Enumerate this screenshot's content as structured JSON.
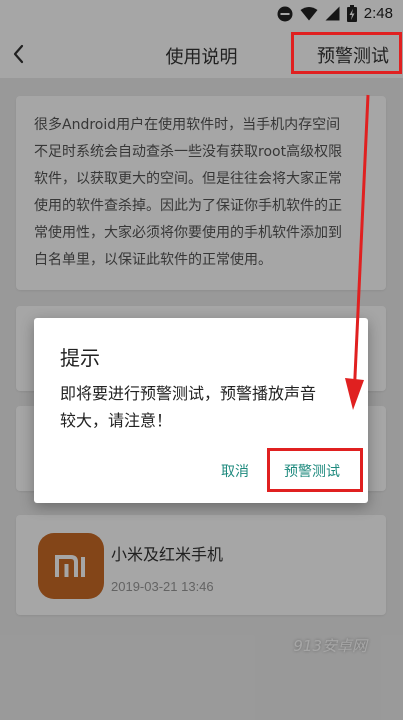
{
  "status_bar": {
    "time": "2:48"
  },
  "app_bar": {
    "title": "使用说明",
    "test_link": "预警测试"
  },
  "info_card": {
    "lines": [
      "很多Android用户在使用软件时，当手机内存空间",
      "不足时系统会自动查杀一些没有获取root高级权限",
      "软件，以获取更大的空间。但是往往会将大家正常",
      "使用的软件查杀掉。因此为了保证你手机软件的正",
      "常使用性，大家必须将你要使用的手机软件添加到",
      "白名单里，以保证此软件的正常使用。"
    ]
  },
  "brand_card": {
    "name": "小米及红米手机",
    "date": "2019-03-21 13:46",
    "logo_text": "mi"
  },
  "watermark": "913安卓网",
  "dialog": {
    "title": "提示",
    "message_lines": [
      "即将要进行预警测试，预警播放声音",
      "较大，请注意！"
    ],
    "cancel_label": "取消",
    "confirm_label": "预警测试"
  },
  "colors": {
    "accent": "#1e8a7e",
    "highlight": "#e02020",
    "brand_orange": "#c96a25"
  },
  "icons": {
    "back": "chevron-left-icon",
    "wifi": "wifi-icon",
    "signal": "signal-icon",
    "battery": "battery-icon",
    "dnd": "do-not-disturb-icon"
  }
}
